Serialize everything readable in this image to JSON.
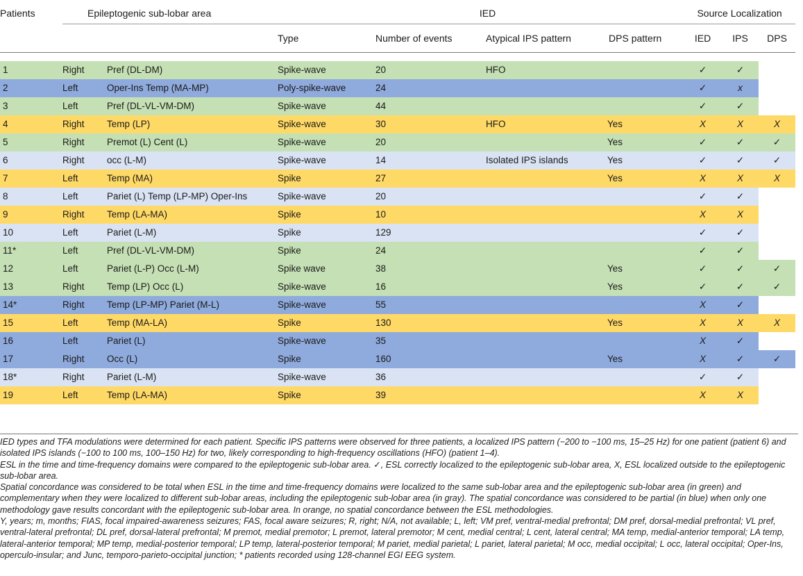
{
  "colors": {
    "green": "#c5e0b4",
    "blue": "#8faadc",
    "lightblue": "#dae3f3",
    "orange": "#ffd966"
  },
  "header": {
    "patients": "Patients",
    "area": "Epileptogenic sub-lobar area",
    "ied": "IED",
    "source": "Source Localization",
    "type": "Type",
    "events": "Number of events",
    "atypical": "Atypical IPS pattern",
    "dps": "DPS pattern",
    "src_ied": "IED",
    "src_ips": "IPS",
    "src_dps": "DPS"
  },
  "rows": [
    {
      "patient": "1",
      "side": "Right",
      "area": "Pref (DL-DM)",
      "type": "Spike-wave",
      "events": "20",
      "atypical": "HFO",
      "dps": "",
      "s_ied": "✓",
      "s_ips": "✓",
      "s_dps": "",
      "color": "green",
      "span": 2
    },
    {
      "patient": "2",
      "side": "Left",
      "area": "Oper-Ins Temp (MA-MP)",
      "type": "Poly-spike-wave",
      "events": "24",
      "atypical": "",
      "dps": "",
      "s_ied": "✓",
      "s_ips": "x",
      "s_dps": "",
      "color": "blue",
      "span": 2
    },
    {
      "patient": "3",
      "side": "Left",
      "area": "Pref (DL-VL-VM-DM)",
      "type": "Spike-wave",
      "events": "44",
      "atypical": "",
      "dps": "",
      "s_ied": "✓",
      "s_ips": "✓",
      "s_dps": "",
      "color": "green",
      "span": 2
    },
    {
      "patient": "4",
      "side": "Right",
      "area": "Temp (LP)",
      "type": "Spike-wave",
      "events": "30",
      "atypical": "HFO",
      "dps": "Yes",
      "s_ied": "X",
      "s_ips": "X",
      "s_dps": "X",
      "color": "orange",
      "span": 3
    },
    {
      "patient": "5",
      "side": "Right",
      "area": "Premot (L) Cent (L)",
      "type": "Spike-wave",
      "events": "20",
      "atypical": "",
      "dps": "Yes",
      "s_ied": "✓",
      "s_ips": "✓",
      "s_dps": "✓",
      "color": "green",
      "span": 3
    },
    {
      "patient": "6",
      "side": "Right",
      "area": "occ (L-M)",
      "type": "Spike-wave",
      "events": "14",
      "atypical": "Isolated IPS islands",
      "dps": "Yes",
      "s_ied": "✓",
      "s_ips": "✓",
      "s_dps": "✓",
      "color": "lightblue",
      "span": 3
    },
    {
      "patient": "7",
      "side": "Left",
      "area": "Temp (MA)",
      "type": "Spike",
      "events": "27",
      "atypical": "",
      "dps": "Yes",
      "s_ied": "X",
      "s_ips": "X",
      "s_dps": "X",
      "color": "orange",
      "span": 3
    },
    {
      "patient": "8",
      "side": "Left",
      "area": "Pariet (L) Temp (LP-MP) Oper-Ins",
      "type": "Spike-wave",
      "events": "20",
      "atypical": "",
      "dps": "",
      "s_ied": "✓",
      "s_ips": "✓",
      "s_dps": "",
      "color": "lightblue",
      "span": 2
    },
    {
      "patient": "9",
      "side": "Right",
      "area": "Temp (LA-MA)",
      "type": "Spike",
      "events": "10",
      "atypical": "",
      "dps": "",
      "s_ied": "X",
      "s_ips": "X",
      "s_dps": "",
      "color": "orange",
      "span": 2
    },
    {
      "patient": "10",
      "side": "Left",
      "area": "Pariet (L-M)",
      "type": "Spike",
      "events": "129",
      "atypical": "",
      "dps": "",
      "s_ied": "✓",
      "s_ips": "✓",
      "s_dps": "",
      "color": "lightblue",
      "span": 2
    },
    {
      "patient": "11*",
      "side": "Left",
      "area": "Pref (DL-VL-VM-DM)",
      "type": "Spike",
      "events": "24",
      "atypical": "",
      "dps": "",
      "s_ied": "✓",
      "s_ips": "✓",
      "s_dps": "",
      "color": "green",
      "span": 2
    },
    {
      "patient": "12",
      "side": "Left",
      "area": "Pariet (L-P) Occ (L-M)",
      "type": "Spike wave",
      "events": "38",
      "atypical": "",
      "dps": "Yes",
      "s_ied": "✓",
      "s_ips": "✓",
      "s_dps": "✓",
      "color": "green",
      "span": 3
    },
    {
      "patient": "13",
      "side": "Right",
      "area": "Temp (LP) Occ (L)",
      "type": "Spike-wave",
      "events": "16",
      "atypical": "",
      "dps": "Yes",
      "s_ied": "✓",
      "s_ips": "✓",
      "s_dps": "✓",
      "color": "green",
      "span": 3
    },
    {
      "patient": "14*",
      "side": "Right",
      "area": "Temp (LP-MP) Pariet (M-L)",
      "type": "Spike-wave",
      "events": "55",
      "atypical": "",
      "dps": "",
      "s_ied": "X",
      "s_ips": "✓",
      "s_dps": "",
      "color": "blue",
      "span": 2
    },
    {
      "patient": "15",
      "side": "Left",
      "area": "Temp (MA-LA)",
      "type": "Spike",
      "events": "130",
      "atypical": "",
      "dps": "Yes",
      "s_ied": "X",
      "s_ips": "X",
      "s_dps": "X",
      "color": "orange",
      "span": 3
    },
    {
      "patient": "16",
      "side": "Left",
      "area": "Pariet (L)",
      "type": "Spike-wave",
      "events": "35",
      "atypical": "",
      "dps": "",
      "s_ied": "X",
      "s_ips": "✓",
      "s_dps": "",
      "color": "blue",
      "span": 2
    },
    {
      "patient": "17",
      "side": "Right",
      "area": "Occ (L)",
      "type": "Spike",
      "events": "160",
      "atypical": "",
      "dps": "Yes",
      "s_ied": "X",
      "s_ips": "✓",
      "s_dps": "✓",
      "color": "blue",
      "span": 3
    },
    {
      "patient": "18*",
      "side": "Right",
      "area": "Pariet (L-M)",
      "type": "Spike-wave",
      "events": "36",
      "atypical": "",
      "dps": "",
      "s_ied": "✓",
      "s_ips": "✓",
      "s_dps": "",
      "color": "lightblue",
      "span": 2
    },
    {
      "patient": "19",
      "side": "Left",
      "area": "Temp (LA-MA)",
      "type": "Spike",
      "events": "39",
      "atypical": "",
      "dps": "",
      "s_ied": "X",
      "s_ips": "X",
      "s_dps": "",
      "color": "orange",
      "span": 2
    }
  ],
  "caption": [
    "IED types and TFA modulations were determined for each patient. Specific IPS patterns were observed for three patients, a localized IPS pattern (−200 to −100 ms, 15–25 Hz) for one patient (patient 6) and isolated IPS islands (−100 to 100 ms, 100–150 Hz) for two, likely corresponding to high-frequency oscillations (HFO) (patient 1–4).",
    "ESL in the time and time-frequency domains were compared to the epileptogenic sub-lobar area. ✓, ESL correctly localized to the epileptogenic sub-lobar area, X, ESL localized outside to the epileptogenic sub-lobar area.",
    "Spatial concordance was considered to be total when ESL in the time and time-frequency domains were localized to the same sub-lobar area and the epileptogenic sub-lobar area (in green) and complementary when they were localized to different sub-lobar areas, including the epileptogenic sub-lobar area (in gray). The spatial concordance was considered to be partial (in blue) when only one methodology gave results concordant with the epileptogenic sub-lobar area. In orange, no spatial concordance between the ESL methodologies.",
    "Y, years; m, months; FIAS, focal impaired-awareness seizures; FAS, focal aware seizures; R, right; N/A, not available; L, left; VM pref, ventral-medial prefrontal; DM pref, dorsal-medial prefrontal; VL pref, ventral-lateral prefrontal; DL pref, dorsal-lateral prefrontal; M premot, medial premotor; L premot, lateral premotor; M cent, medial central; L cent, lateral central; MA temp, medial-anterior temporal; LA temp, lateral-anterior temporal; MP temp, medial-posterior temporal; LP temp, lateral-posterior temporal; M pariet, medial parietal; L pariet, lateral parietal; M occ, medial occipital; L occ, lateral occipital; Oper-Ins, operculo-insular; and Junc, temporo-parieto-occipital junction; * patients recorded using 128-channel EGI EEG system."
  ]
}
